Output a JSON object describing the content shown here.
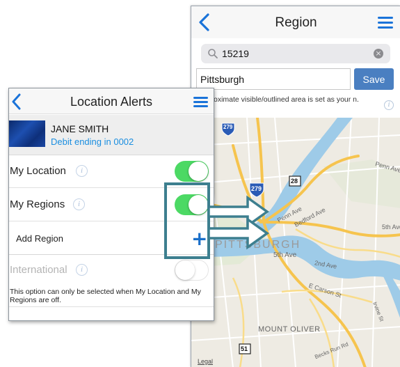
{
  "region": {
    "title": "Region",
    "search_value": "15219",
    "region_name_value": "Pittsburgh",
    "save_label": "Save",
    "note_text": "oximate visible/outlined area is set as your n.",
    "map_labels": {
      "city": "PITTSBURGH",
      "ave_5th_left": "5th Ave",
      "ave_5th_right": "5th Ave",
      "penn_ave_left": "Penn Ave",
      "penn_ave_right": "Penn Ave",
      "bedford": "Bedford Ave",
      "ave_2nd": "2nd Ave",
      "carson": "E Carson St",
      "mount_oliver": "MOUNT OLIVER",
      "becks_run": "Becks Run Rd",
      "irvine": "Irvine St",
      "legal": "Legal",
      "shield_279_top": "279",
      "shield_279_mid": "279",
      "shield_28": "28",
      "shield_51": "51"
    }
  },
  "alerts": {
    "title": "Location Alerts",
    "account_name": "JANE SMITH",
    "account_detail": "Debit ending in 0002",
    "rows": {
      "my_location": "My Location",
      "my_regions": "My Regions",
      "add_region": "Add Region",
      "international": "International"
    },
    "toggles": {
      "my_location": true,
      "my_regions": true,
      "international": false
    },
    "add_symbol": "+",
    "footer_note": "This option can only be selected when My Location and My Regions are off."
  },
  "colors": {
    "accent_blue": "#1a73d9",
    "toggle_on": "#4cd964",
    "callout_teal": "#3d7f8f",
    "river": "#9ecbe8",
    "highway": "#f6c44e"
  }
}
